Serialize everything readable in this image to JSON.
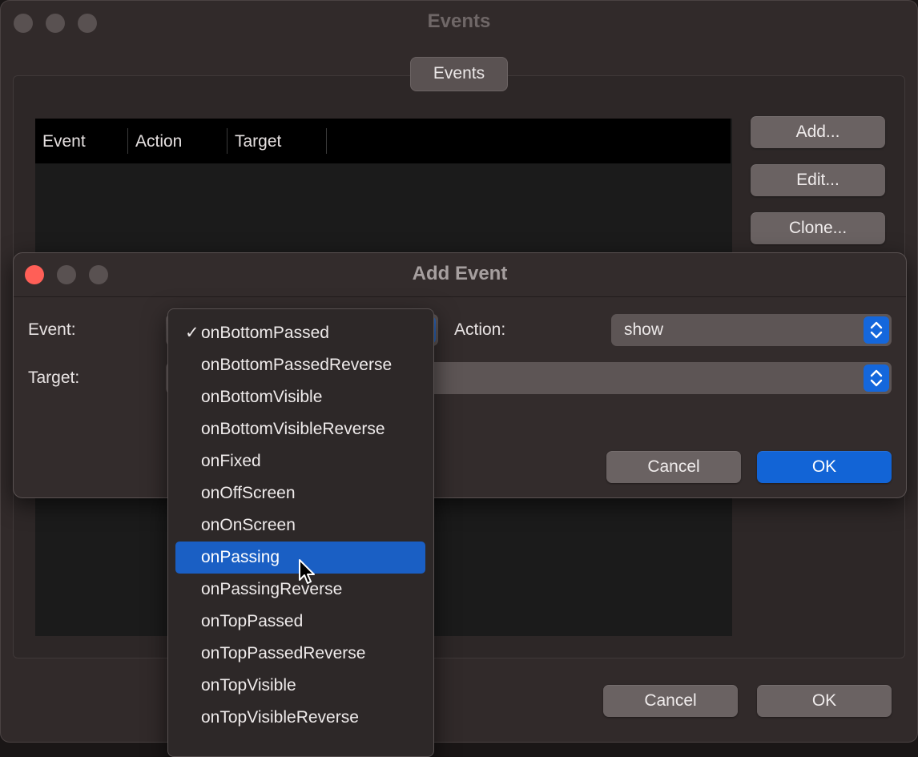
{
  "window": {
    "title": "Events",
    "group_title": "Events",
    "table_headers": [
      "Event",
      "Action",
      "Target"
    ],
    "buttons": {
      "add": "Add...",
      "edit": "Edit...",
      "clone": "Clone...",
      "cancel": "Cancel",
      "ok": "OK"
    }
  },
  "dialog": {
    "title": "Add Event",
    "event_label": "Event:",
    "action_label": "Action:",
    "target_label": "Target:",
    "action_value": "show",
    "cancel_label": "Cancel",
    "ok_label": "OK"
  },
  "event_menu": {
    "checked_item": "onBottomPassed",
    "highlighted_item": "onPassing",
    "items": [
      "onBottomPassed",
      "onBottomPassedReverse",
      "onBottomVisible",
      "onBottomVisibleReverse",
      "onFixed",
      "onOffScreen",
      "onOnScreen",
      "onPassing",
      "onPassingReverse",
      "onTopPassed",
      "onTopPassedReverse",
      "onTopVisible",
      "onTopVisibleReverse"
    ]
  },
  "colors": {
    "accent": "#1264d6",
    "menu_highlight": "#1a5fc4",
    "close_light": "#ff5f57"
  }
}
